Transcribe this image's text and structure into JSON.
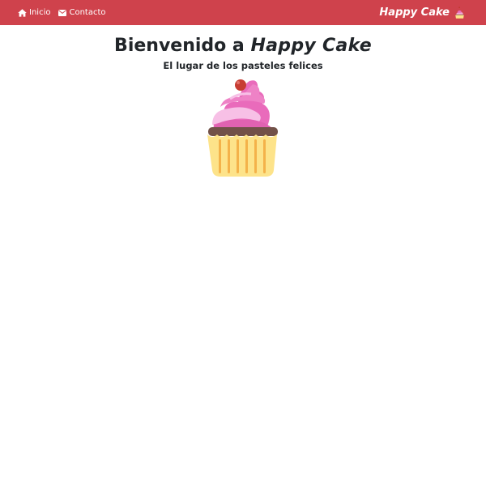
{
  "navbar": {
    "background": "#cf424c",
    "links": [
      {
        "label": "Inicio",
        "icon": "home-icon"
      },
      {
        "label": "Contacto",
        "icon": "envelope-icon"
      }
    ],
    "brand": {
      "label": "Happy Cake",
      "icon": "cupcake-icon"
    }
  },
  "hero": {
    "title_prefix": "Bienvenido a ",
    "title_brand": "Happy Cake",
    "subtitle": "El lugar de los pasteles felices",
    "image": "cupcake-illustration"
  }
}
